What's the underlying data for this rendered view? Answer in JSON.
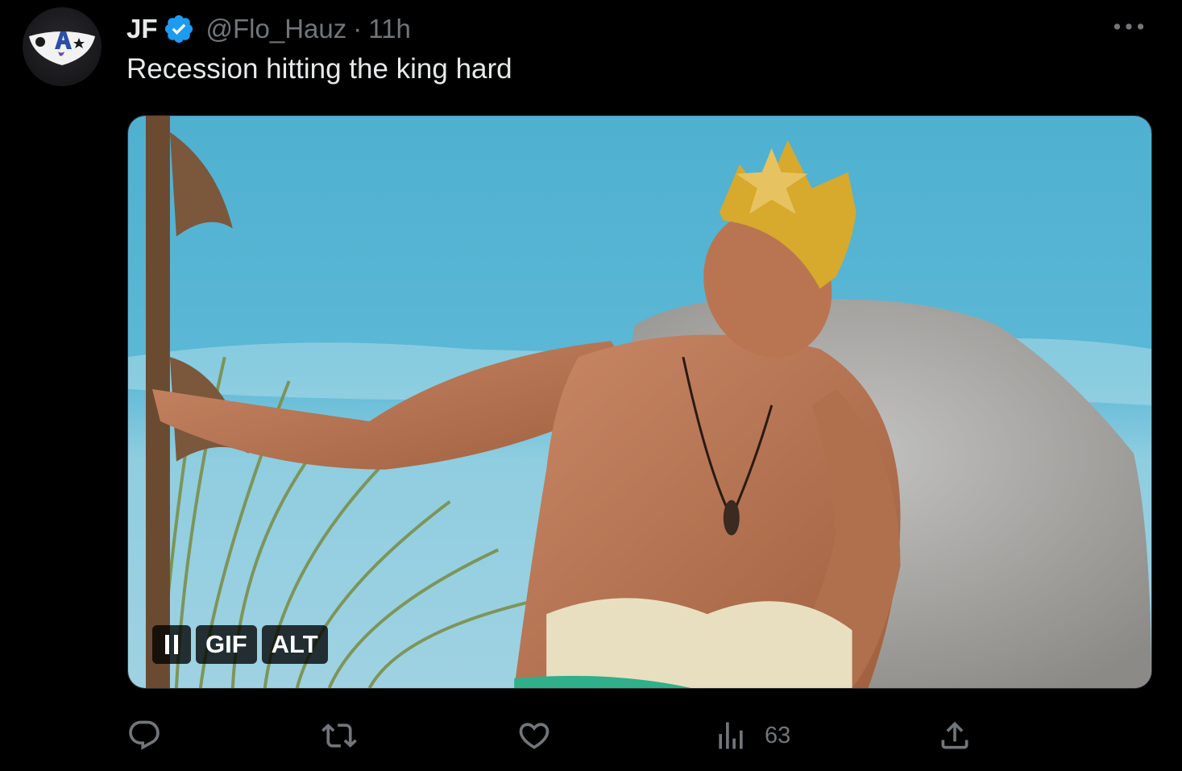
{
  "author": {
    "name": "JF",
    "handle": "@Flo_Hauz",
    "separator": "·",
    "time": "11h",
    "verified_color": "#1d9bf0"
  },
  "tweet": {
    "text": "Recession hitting the king hard"
  },
  "media": {
    "type": "gif",
    "controls": {
      "pause_icon": "pause-icon",
      "gif_label": "GIF",
      "alt_label": "ALT"
    }
  },
  "actions": {
    "reply_icon": "reply-icon",
    "retweet_icon": "retweet-icon",
    "like_icon": "heart-icon",
    "views_icon": "analytics-icon",
    "views_count": "63",
    "share_icon": "share-icon"
  },
  "colors": {
    "background": "#000000",
    "text": "#e7e9ea",
    "secondary": "#71767b"
  }
}
